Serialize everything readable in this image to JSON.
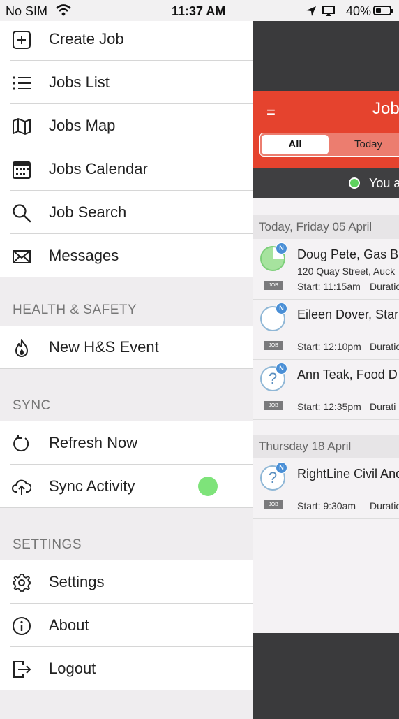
{
  "status_bar": {
    "carrier": "No SIM",
    "time": "11:37 AM",
    "battery": "40%",
    "battery_level": 0.4
  },
  "menu": {
    "main_items": [
      {
        "label": "Create Job",
        "icon": "plus-square-icon"
      },
      {
        "label": "Jobs List",
        "icon": "list-icon"
      },
      {
        "label": "Jobs Map",
        "icon": "map-icon"
      },
      {
        "label": "Jobs Calendar",
        "icon": "calendar-icon"
      },
      {
        "label": "Job Search",
        "icon": "search-icon"
      },
      {
        "label": "Messages",
        "icon": "envelope-icon"
      }
    ],
    "health_safety": {
      "title": "HEALTH & SAFETY",
      "items": [
        {
          "label": "New H&S Event",
          "icon": "flame-icon"
        }
      ]
    },
    "sync": {
      "title": "SYNC",
      "items": [
        {
          "label": "Refresh Now",
          "icon": "refresh-icon"
        },
        {
          "label": "Sync Activity",
          "icon": "cloud-upload-icon",
          "status_color": "#7ee37a"
        }
      ]
    },
    "settings": {
      "title": "SETTINGS",
      "items": [
        {
          "label": "Settings",
          "icon": "gear-icon"
        },
        {
          "label": "About",
          "icon": "info-icon"
        },
        {
          "label": "Logout",
          "icon": "logout-icon"
        }
      ]
    }
  },
  "background_app": {
    "header_color": "#e5432e",
    "menu_glyph": "=",
    "title": "Job",
    "tabs": {
      "all": "All",
      "today": "Today"
    },
    "online_text": "You a",
    "sections": [
      {
        "title": "Today, Friday 05 April",
        "jobs": [
          {
            "name": "Doug Pete, Gas B",
            "address": "120 Quay Street, Auck",
            "start": "Start: 11:15am",
            "duration": "Duratio",
            "badge": "N",
            "tag": "JOB"
          },
          {
            "name": "Eileen Dover, Star",
            "address": "",
            "start": "Start: 12:10pm",
            "duration": "Duratio",
            "badge": "N",
            "tag": "JOB"
          },
          {
            "name": "Ann Teak, Food D",
            "address": "",
            "start": "Start: 12:35pm",
            "duration": "Durati",
            "badge": "N",
            "tag": "JOB",
            "icon_glyph": "?"
          }
        ]
      },
      {
        "title": "Thursday 18 April",
        "jobs": [
          {
            "name": "RightLine Civil And",
            "address": "",
            "start": "Start: 9:30am",
            "duration": "Duratio",
            "badge": "N",
            "tag": "JOB",
            "icon_glyph": "?"
          }
        ]
      }
    ]
  }
}
